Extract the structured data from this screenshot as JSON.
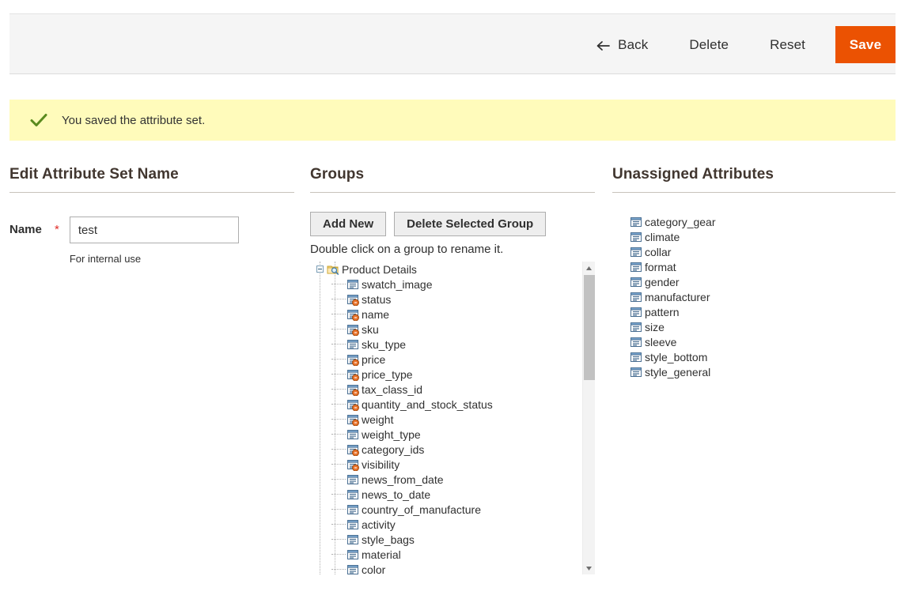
{
  "colors": {
    "accent": "#eb5202",
    "success_bg": "#fffbbb",
    "success_check": "#5a8a1e",
    "header_bg": "#f5f5f5",
    "required_star": "#e02b27",
    "heading": "#41362f"
  },
  "header": {
    "back_label": "Back",
    "delete_label": "Delete",
    "reset_label": "Reset",
    "save_label": "Save",
    "back_icon": "arrow-left-icon"
  },
  "message": {
    "icon": "check-icon",
    "text": "You saved the attribute set."
  },
  "left": {
    "title": "Edit Attribute Set Name",
    "name_label": "Name",
    "required_marker": "*",
    "name_value": "test",
    "name_placeholder": "",
    "name_note": "For internal use"
  },
  "groups": {
    "title": "Groups",
    "add_new_label": "Add New",
    "delete_group_label": "Delete Selected Group",
    "hint": "Double click on a group to rename it.",
    "root": {
      "label": "Product Details",
      "icon": "folder-search-icon",
      "toggle_icon": "collapse-minus-icon"
    },
    "attributes": [
      {
        "label": "swatch_image",
        "icon": "attribute-icon"
      },
      {
        "label": "status",
        "icon": "attribute-system-icon"
      },
      {
        "label": "name",
        "icon": "attribute-system-icon"
      },
      {
        "label": "sku",
        "icon": "attribute-system-icon"
      },
      {
        "label": "sku_type",
        "icon": "attribute-icon"
      },
      {
        "label": "price",
        "icon": "attribute-system-icon"
      },
      {
        "label": "price_type",
        "icon": "attribute-system-icon"
      },
      {
        "label": "tax_class_id",
        "icon": "attribute-system-icon"
      },
      {
        "label": "quantity_and_stock_status",
        "icon": "attribute-system-icon"
      },
      {
        "label": "weight",
        "icon": "attribute-system-icon"
      },
      {
        "label": "weight_type",
        "icon": "attribute-icon"
      },
      {
        "label": "category_ids",
        "icon": "attribute-system-icon"
      },
      {
        "label": "visibility",
        "icon": "attribute-system-icon"
      },
      {
        "label": "news_from_date",
        "icon": "attribute-icon"
      },
      {
        "label": "news_to_date",
        "icon": "attribute-icon"
      },
      {
        "label": "country_of_manufacture",
        "icon": "attribute-icon"
      },
      {
        "label": "activity",
        "icon": "attribute-icon"
      },
      {
        "label": "style_bags",
        "icon": "attribute-icon"
      },
      {
        "label": "material",
        "icon": "attribute-icon"
      },
      {
        "label": "color",
        "icon": "attribute-icon"
      }
    ],
    "scrollbar": {
      "up_icon": "caret-up-icon",
      "down_icon": "caret-down-icon"
    }
  },
  "unassigned": {
    "title": "Unassigned Attributes",
    "items": [
      {
        "label": "category_gear",
        "icon": "attribute-icon"
      },
      {
        "label": "climate",
        "icon": "attribute-icon"
      },
      {
        "label": "collar",
        "icon": "attribute-icon"
      },
      {
        "label": "format",
        "icon": "attribute-icon"
      },
      {
        "label": "gender",
        "icon": "attribute-icon"
      },
      {
        "label": "manufacturer",
        "icon": "attribute-icon"
      },
      {
        "label": "pattern",
        "icon": "attribute-icon"
      },
      {
        "label": "size",
        "icon": "attribute-icon"
      },
      {
        "label": "sleeve",
        "icon": "attribute-icon"
      },
      {
        "label": "style_bottom",
        "icon": "attribute-icon"
      },
      {
        "label": "style_general",
        "icon": "attribute-icon"
      }
    ]
  }
}
